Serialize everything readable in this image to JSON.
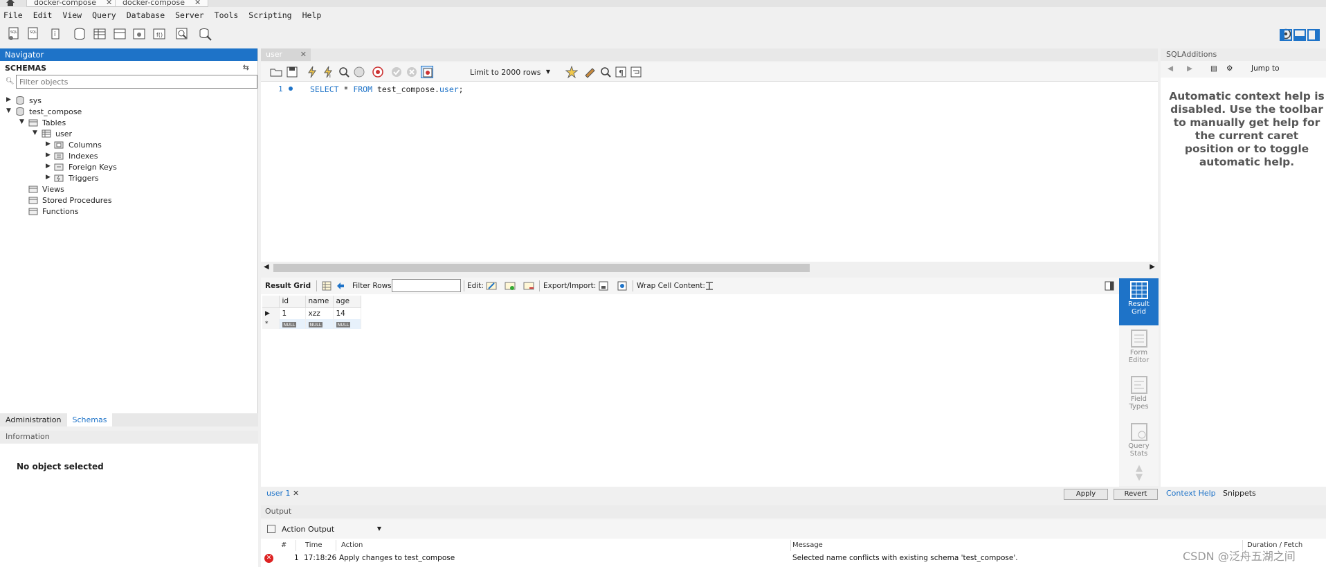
{
  "window_tabs": [
    {
      "label": "docker-compose"
    },
    {
      "label": "docker-compose"
    }
  ],
  "menu": [
    "File",
    "Edit",
    "View",
    "Query",
    "Database",
    "Server",
    "Tools",
    "Scripting",
    "Help"
  ],
  "navigator": {
    "title": "Navigator",
    "schemas_label": "SCHEMAS",
    "filter_placeholder": "Filter objects",
    "tree": {
      "sys": "sys",
      "test_compose": "test_compose",
      "tables": "Tables",
      "user": "user",
      "columns": "Columns",
      "indexes": "Indexes",
      "foreign_keys": "Foreign Keys",
      "triggers": "Triggers",
      "views": "Views",
      "stored_procedures": "Stored Procedures",
      "functions": "Functions"
    },
    "bottom_tabs": [
      "Administration",
      "Schemas"
    ],
    "info_title": "Information",
    "no_object": "No object selected"
  },
  "editor": {
    "tab_label": "user",
    "limit_label": "Limit to 2000 rows",
    "line_number": "1",
    "sql": {
      "select": "SELECT",
      "star": " * ",
      "from": "FROM",
      "schema": " test_compose.",
      "table": "user",
      "end": ";"
    }
  },
  "result": {
    "grid_label": "Result Grid",
    "filter_rows_label": "Filter Rows:",
    "edit_label": "Edit:",
    "export_label": "Export/Import:",
    "wrap_label": "Wrap Cell Content:",
    "columns": [
      "id",
      "name",
      "age"
    ],
    "rows": [
      [
        "1",
        "xzz",
        "14"
      ]
    ],
    "null_label": "NULL",
    "side_buttons": [
      {
        "line1": "Result",
        "line2": "Grid"
      },
      {
        "line1": "Form",
        "line2": "Editor"
      },
      {
        "line1": "Field",
        "line2": "Types"
      },
      {
        "line1": "Query",
        "line2": "Stats"
      }
    ],
    "bottom_tab": "user 1",
    "apply_label": "Apply",
    "revert_label": "Revert"
  },
  "output": {
    "title": "Output",
    "select_value": "Action Output",
    "headers": {
      "num": "#",
      "time": "Time",
      "action": "Action",
      "message": "Message",
      "duration": "Duration / Fetch"
    },
    "rows": [
      {
        "num": "1",
        "time": "17:18:26",
        "action": "Apply changes to test_compose",
        "message": "Selected name conflicts with existing schema 'test_compose'."
      }
    ]
  },
  "sqladditions": {
    "title": "SQLAdditions",
    "jump_to": "Jump to",
    "context_help": "Automatic context help is disabled. Use the toolbar to manually get help for the current caret position or to toggle automatic help.",
    "tabs": [
      "Context Help",
      "Snippets"
    ]
  },
  "watermark": "CSDN @泛舟五湖之间",
  "colors": {
    "accent": "#1e73c8",
    "error": "#d22222"
  }
}
